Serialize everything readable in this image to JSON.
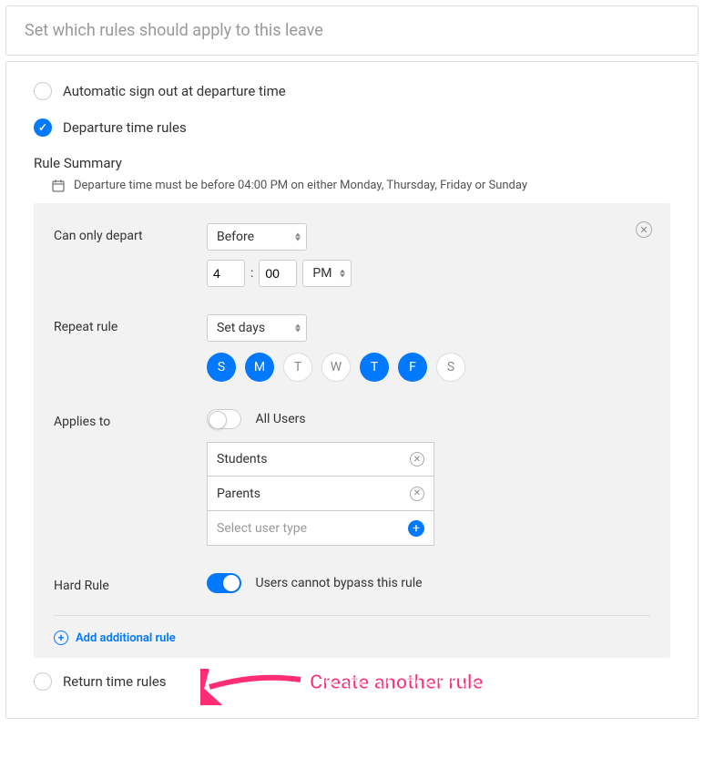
{
  "header": {
    "title": "Set which rules should apply to this leave"
  },
  "options": {
    "auto_signout": "Automatic sign out at departure time",
    "departure_rules": "Departure time rules",
    "return_rules": "Return time rules"
  },
  "rule_summary": {
    "title": "Rule Summary",
    "text": "Departure time must be before 04:00 PM on either Monday, Thursday, Friday or Sunday"
  },
  "rule": {
    "depart_label": "Can only depart",
    "depart_condition": "Before",
    "time_hour": "4",
    "time_minute": "00",
    "time_period": "PM",
    "repeat_label": "Repeat rule",
    "repeat_mode": "Set days",
    "days": [
      {
        "label": "S",
        "on": true
      },
      {
        "label": "M",
        "on": true
      },
      {
        "label": "T",
        "on": false
      },
      {
        "label": "W",
        "on": false
      },
      {
        "label": "T",
        "on": true
      },
      {
        "label": "F",
        "on": true
      },
      {
        "label": "S",
        "on": false
      }
    ],
    "applies_label": "Applies to",
    "applies_all_label": "All Users",
    "applies_list": [
      "Students",
      "Parents"
    ],
    "applies_placeholder": "Select user type",
    "hard_rule_label": "Hard Rule",
    "hard_rule_text": "Users cannot bypass this rule",
    "add_rule_text": "Add additional rule"
  },
  "annotation": {
    "text": "Create another rule"
  }
}
